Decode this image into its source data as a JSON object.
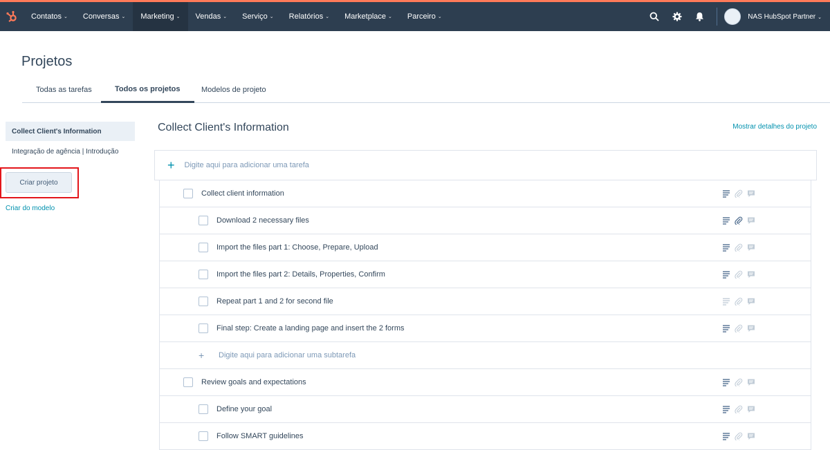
{
  "nav": {
    "items": [
      {
        "label": "Contatos",
        "active": false
      },
      {
        "label": "Conversas",
        "active": false
      },
      {
        "label": "Marketing",
        "active": true
      },
      {
        "label": "Vendas",
        "active": false
      },
      {
        "label": "Serviço",
        "active": false
      },
      {
        "label": "Relatórios",
        "active": false
      },
      {
        "label": "Marketplace",
        "active": false
      },
      {
        "label": "Parceiro",
        "active": false
      }
    ],
    "account_name": "NAS HubSpot Partner",
    "brand_color": "#ff7a59",
    "bar_color": "#2d3e50"
  },
  "page": {
    "title": "Projetos",
    "tabs": [
      {
        "label": "Todas as tarefas"
      },
      {
        "label": "Todos os projetos"
      },
      {
        "label": "Modelos de projeto"
      }
    ]
  },
  "sidebar": {
    "items": [
      {
        "label": "Collect Client's Information"
      },
      {
        "label": "Integração de agência | Introdução"
      }
    ],
    "create_button": "Criar projeto",
    "create_from_template": "Criar do modelo"
  },
  "project": {
    "title": "Collect Client's Information",
    "show_details": "Mostrar detalhes do projeto",
    "add_task_placeholder": "Digite aqui para adicionar uma tarefa",
    "add_subtask_placeholder": "Digite aqui para adicionar uma subtarefa",
    "tasks": [
      {
        "label": "Collect client information",
        "level": "parent"
      },
      {
        "label": "Download 2 necessary files",
        "level": "child"
      },
      {
        "label": "Import the files part 1: Choose, Prepare, Upload",
        "level": "child"
      },
      {
        "label": "Import the files part 2: Details, Properties, Confirm",
        "level": "child"
      },
      {
        "label": "Repeat part 1 and 2 for second file",
        "level": "child"
      },
      {
        "label": "Final step: Create a landing page and insert the 2 forms",
        "level": "child"
      },
      {
        "label": "Review goals and expectations",
        "level": "parent"
      },
      {
        "label": "Define your goal",
        "level": "child"
      },
      {
        "label": "Follow SMART guidelines",
        "level": "child"
      }
    ]
  }
}
